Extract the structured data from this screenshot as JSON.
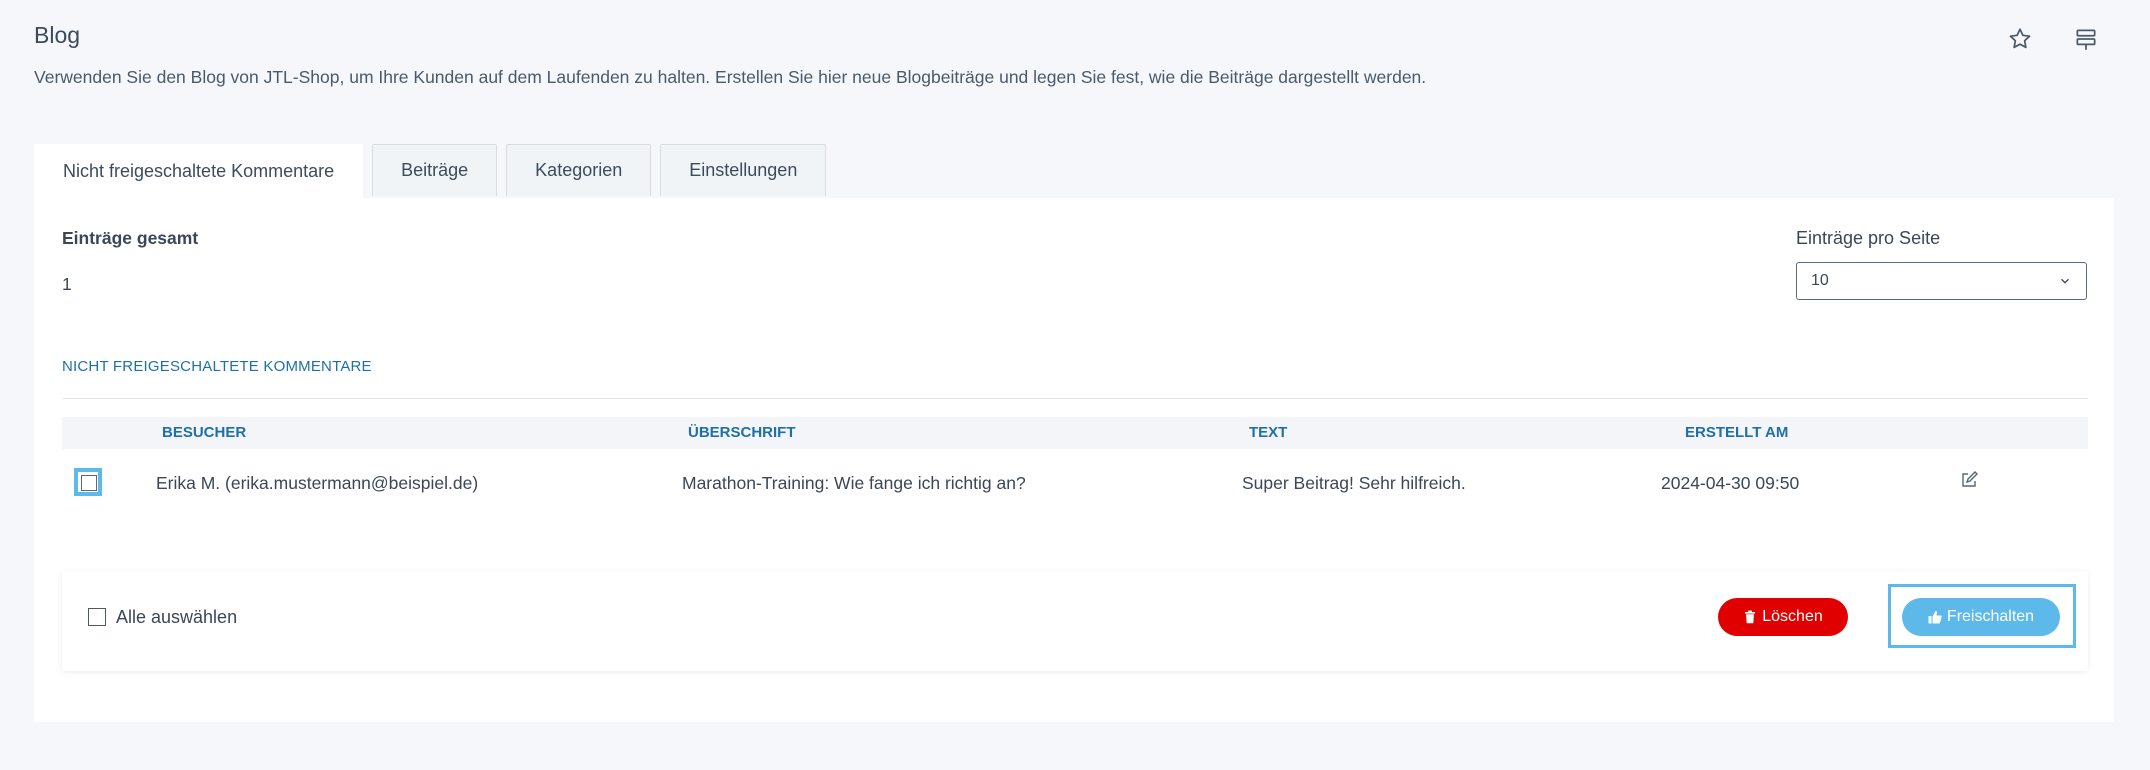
{
  "header": {
    "title": "Blog",
    "description": "Verwenden Sie den Blog von JTL-Shop, um Ihre Kunden auf dem Laufenden zu halten. Erstellen Sie hier neue Blogbeiträge und legen Sie fest, wie die Beiträge dargestellt werden.",
    "icons": [
      "star-icon",
      "layout-icon"
    ]
  },
  "tabs": [
    {
      "label": "Nicht freigeschaltete Kommentare",
      "active": true
    },
    {
      "label": "Beiträge",
      "active": false
    },
    {
      "label": "Kategorien",
      "active": false
    },
    {
      "label": "Einstellungen",
      "active": false
    }
  ],
  "summary": {
    "total_label": "Einträge gesamt",
    "total_value": "1",
    "per_page_label": "Einträge pro Seite",
    "per_page_value": "10"
  },
  "section_title": "NICHT FREIGESCHALTETE KOMMENTARE",
  "table": {
    "columns": [
      "BESUCHER",
      "ÜBERSCHRIFT",
      "TEXT",
      "ERSTELLT AM"
    ],
    "rows": [
      {
        "visitor": "Erika M. (erika.mustermann@beispiel.de)",
        "heading": "Marathon-Training: Wie fange ich richtig an?",
        "text": "Super Beitrag! Sehr hilfreich.",
        "created": "2024-04-30 09:50",
        "checked": false
      }
    ]
  },
  "footer": {
    "select_all_label": "Alle auswählen",
    "delete_label": "Löschen",
    "approve_label": "Freischalten"
  },
  "colors": {
    "accent": "#1f6fa8",
    "delete": "#e10000",
    "approve": "#5cb9ea",
    "background": "#f5f7fa"
  }
}
